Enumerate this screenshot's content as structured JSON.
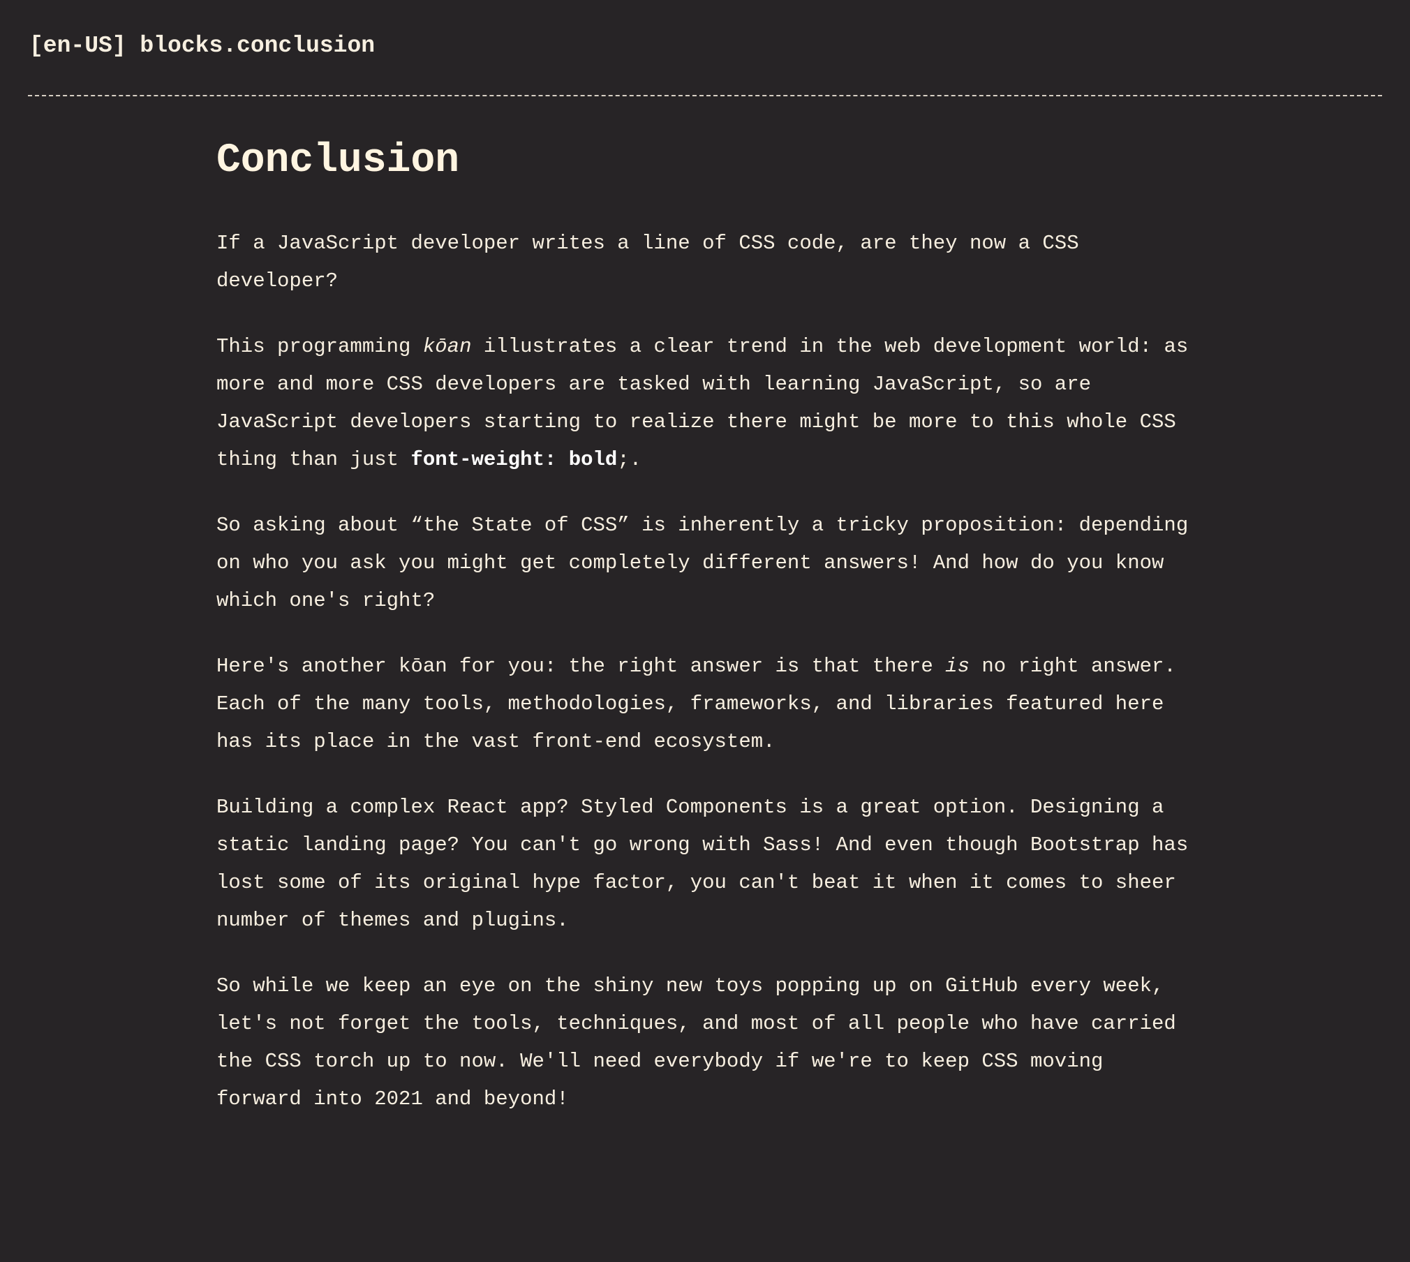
{
  "header": {
    "locale_key": "[en-US] blocks.conclusion"
  },
  "main": {
    "title": "Conclusion",
    "p1": "If a JavaScript developer writes a line of CSS code, are they now a CSS developer?",
    "p2": {
      "a": "This programming ",
      "em": "kōan",
      "b": " illustrates a clear trend in the web development world: as more and more CSS developers are tasked with learning JavaScript, so are JavaScript developers starting to realize there might be more to this whole CSS thing than just ",
      "code": "font-weight: bold",
      "c": ";."
    },
    "p3": "So asking about “the State of CSS” is inherently a tricky proposition: depending on who you ask you might get completely different answers! And how do you know which one's right?",
    "p4": {
      "a": "Here's another kōan for you: the right answer is that there ",
      "em": "is",
      "b": " no right answer. Each of the many tools, methodologies, frameworks, and libraries featured here has its place in the vast front-end ecosystem."
    },
    "p5": "Building a complex React app? Styled Components is a great option. Designing a static landing page? You can't go wrong with Sass! And even though Bootstrap has lost some of its original hype factor, you can't beat it when it comes to sheer number of themes and plugins.",
    "p6": "So while we keep an eye on the shiny new toys popping up on GitHub every week, let's not forget the tools, techniques, and most of all people who have carried the CSS torch up to now. We'll need everybody if we're to keep CSS moving forward into 2021 and beyond!"
  }
}
